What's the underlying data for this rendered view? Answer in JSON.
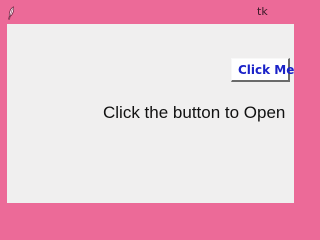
{
  "window": {
    "title": "tk",
    "app_icon": "feather-icon",
    "frame_color": "#ec6a98",
    "background_color": "#f0efef"
  },
  "main": {
    "button_label": "Click Me",
    "button_text_color": "#1a22c8",
    "message": "Click the button to Open"
  }
}
